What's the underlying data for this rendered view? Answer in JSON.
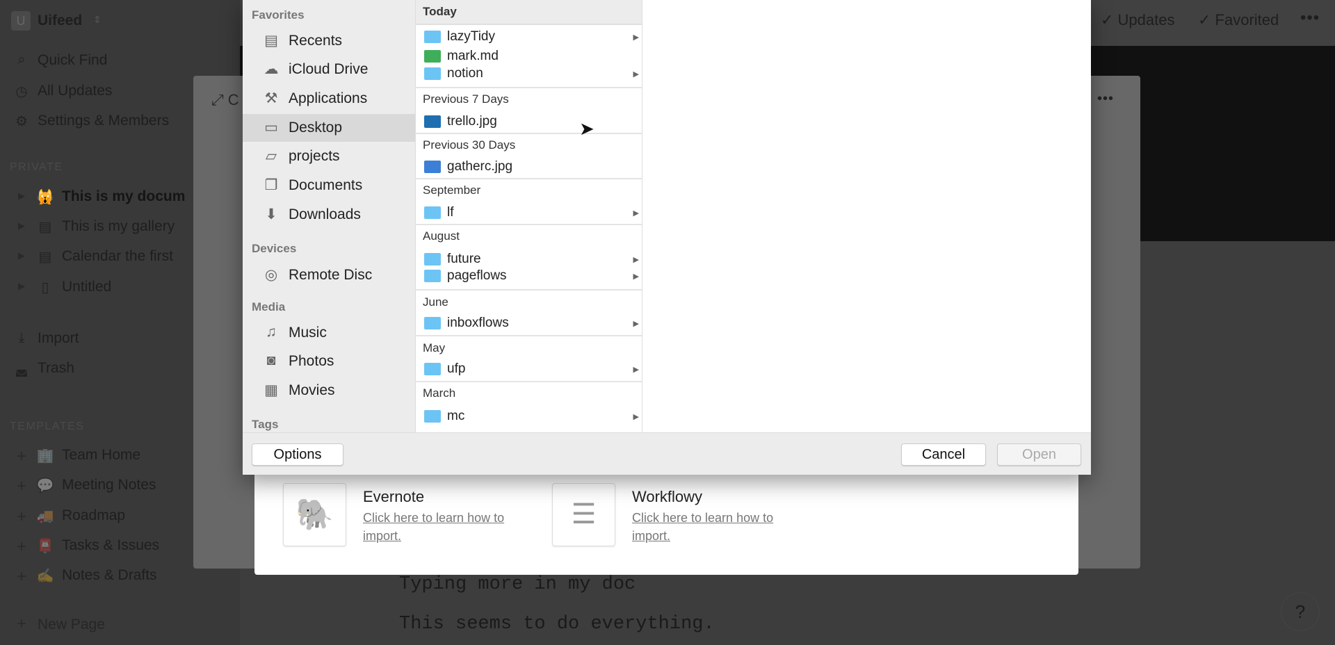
{
  "sidebar": {
    "workspace": "Uifeed",
    "workspace_initial": "U",
    "nav": [
      {
        "label": "Quick Find",
        "icon": "search-icon"
      },
      {
        "label": "All Updates",
        "icon": "clock-icon"
      },
      {
        "label": "Settings & Members",
        "icon": "gear-icon"
      }
    ],
    "private_label": "PRIVATE",
    "pages": [
      {
        "label": "This is my docum",
        "icon": "cat-emoji-icon",
        "bold": true
      },
      {
        "label": "This is my gallery",
        "icon": "document-icon"
      },
      {
        "label": "Calendar the first",
        "icon": "document-icon"
      },
      {
        "label": "Untitled",
        "icon": "blank-page-icon"
      }
    ],
    "actions": [
      {
        "label": "Import",
        "icon": "download-icon"
      },
      {
        "label": "Trash",
        "icon": "trash-icon"
      }
    ],
    "templates_label": "TEMPLATES",
    "templates": [
      {
        "label": "Team Home",
        "emoji": "🏢"
      },
      {
        "label": "Meeting Notes",
        "emoji": "💬"
      },
      {
        "label": "Roadmap",
        "emoji": "🚚"
      },
      {
        "label": "Tasks & Issues",
        "emoji": "📮"
      },
      {
        "label": "Notes & Drafts",
        "emoji": "✍"
      }
    ],
    "new_page": "New Page"
  },
  "topbar": {
    "updates": "Updates",
    "favorited": "Favorited"
  },
  "import_modal": {
    "header_partial": "C",
    "sources": [
      {
        "title": "Evernote",
        "link": "Click here to learn how to import."
      },
      {
        "title": "Workflowy",
        "link": "Click here to learn how to import."
      }
    ]
  },
  "document": {
    "lines": [
      "Typing more in my doc",
      "This seems to do everything."
    ]
  },
  "file_dialog": {
    "sidebar": [
      {
        "header": "Favorites",
        "items": [
          {
            "label": "Recents",
            "icon": "recents-icon"
          },
          {
            "label": "iCloud Drive",
            "icon": "cloud-icon"
          },
          {
            "label": "Applications",
            "icon": "applications-icon"
          },
          {
            "label": "Desktop",
            "icon": "desktop-icon",
            "selected": true
          },
          {
            "label": "projects",
            "icon": "folder-icon"
          },
          {
            "label": "Documents",
            "icon": "documents-icon"
          },
          {
            "label": "Downloads",
            "icon": "downloads-icon"
          }
        ]
      },
      {
        "header": "Devices",
        "items": [
          {
            "label": "Remote Disc",
            "icon": "disc-icon"
          }
        ]
      },
      {
        "header": "Media",
        "items": [
          {
            "label": "Music",
            "icon": "music-icon"
          },
          {
            "label": "Photos",
            "icon": "camera-icon"
          },
          {
            "label": "Movies",
            "icon": "film-icon"
          }
        ]
      },
      {
        "header": "Tags",
        "items": []
      }
    ],
    "groups": [
      {
        "header": "Today",
        "items": [
          {
            "name": "lazyTidy",
            "type": "folder"
          },
          {
            "name": "mark.md",
            "type": "atom-file"
          },
          {
            "name": "notion",
            "type": "folder"
          }
        ]
      },
      {
        "header": "Previous 7 Days",
        "items": [
          {
            "name": "trello.jpg",
            "type": "trello-image"
          }
        ]
      },
      {
        "header": "Previous 30 Days",
        "items": [
          {
            "name": "gatherc.jpg",
            "type": "image"
          }
        ]
      },
      {
        "header": "September",
        "items": [
          {
            "name": "lf",
            "type": "folder"
          }
        ]
      },
      {
        "header": "August",
        "items": [
          {
            "name": "future",
            "type": "folder"
          },
          {
            "name": "pageflows",
            "type": "folder"
          }
        ]
      },
      {
        "header": "June",
        "items": [
          {
            "name": "inboxflows",
            "type": "folder"
          }
        ]
      },
      {
        "header": "May",
        "items": [
          {
            "name": "ufp",
            "type": "folder"
          }
        ]
      },
      {
        "header": "March",
        "items": [
          {
            "name": "mc",
            "type": "folder"
          }
        ]
      }
    ],
    "options": "Options",
    "cancel": "Cancel",
    "open": "Open"
  },
  "help": "?",
  "colors": {
    "folder": "#6cc4f5",
    "selected_row": "#d9d9d9",
    "dim_overlay": "#3d3d3d"
  }
}
